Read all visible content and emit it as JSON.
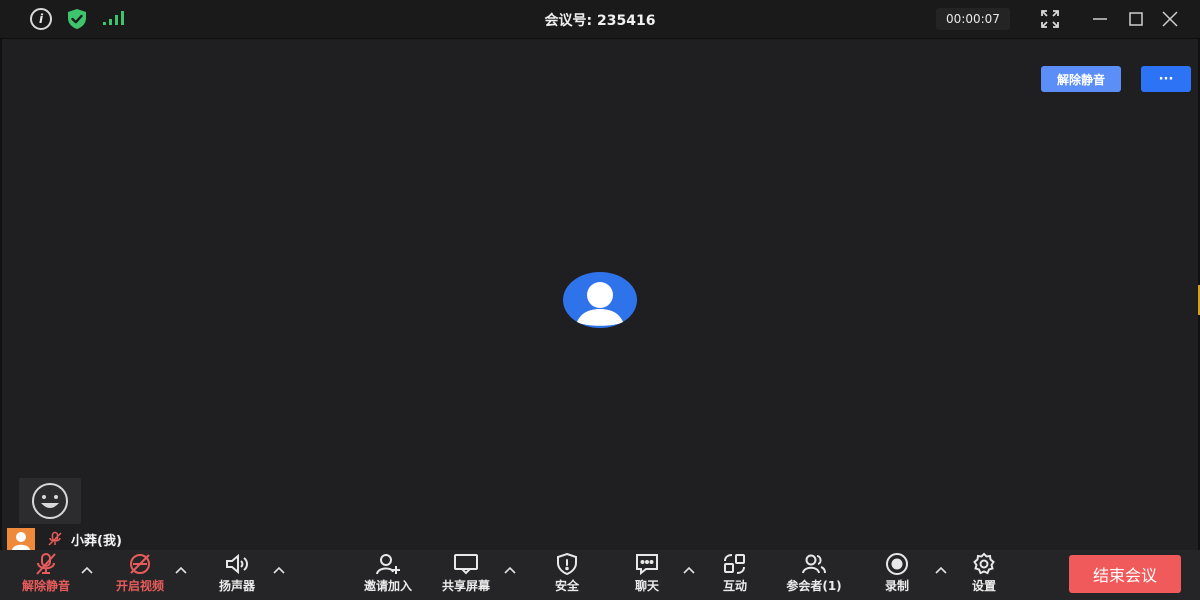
{
  "titlebar": {
    "meeting_id": "会议号: 235416",
    "timer": "00:00:07",
    "info_icon_glyph": "i",
    "shield_color": "#3ec46d",
    "signal_color": "#3ec46d"
  },
  "stage": {
    "unmute_button": "解除静音",
    "more_button": "···",
    "accent": "#2d73f5",
    "avatar_color": "#2f73ea"
  },
  "self": {
    "name": "小莽(我)",
    "avatar_color": "#f08a3b"
  },
  "toolbar": {
    "items": [
      {
        "label": "解除静音",
        "icon": "mic-off-icon"
      },
      {
        "label": "开启视频",
        "icon": "video-off-icon"
      },
      {
        "label": "扬声器",
        "icon": "speaker-icon"
      },
      {
        "label": "邀请加入",
        "icon": "invite-icon"
      },
      {
        "label": "共享屏幕",
        "icon": "share-screen-icon"
      },
      {
        "label": "安全",
        "icon": "security-icon"
      },
      {
        "label": "聊天",
        "icon": "chat-icon"
      },
      {
        "label": "互动",
        "icon": "interact-icon"
      },
      {
        "label": "参会者(1)",
        "icon": "participants-icon"
      },
      {
        "label": "录制",
        "icon": "record-icon"
      },
      {
        "label": "设置",
        "icon": "settings-icon"
      }
    ],
    "end_meeting": "结束会议",
    "end_color": "#f05a5a"
  }
}
